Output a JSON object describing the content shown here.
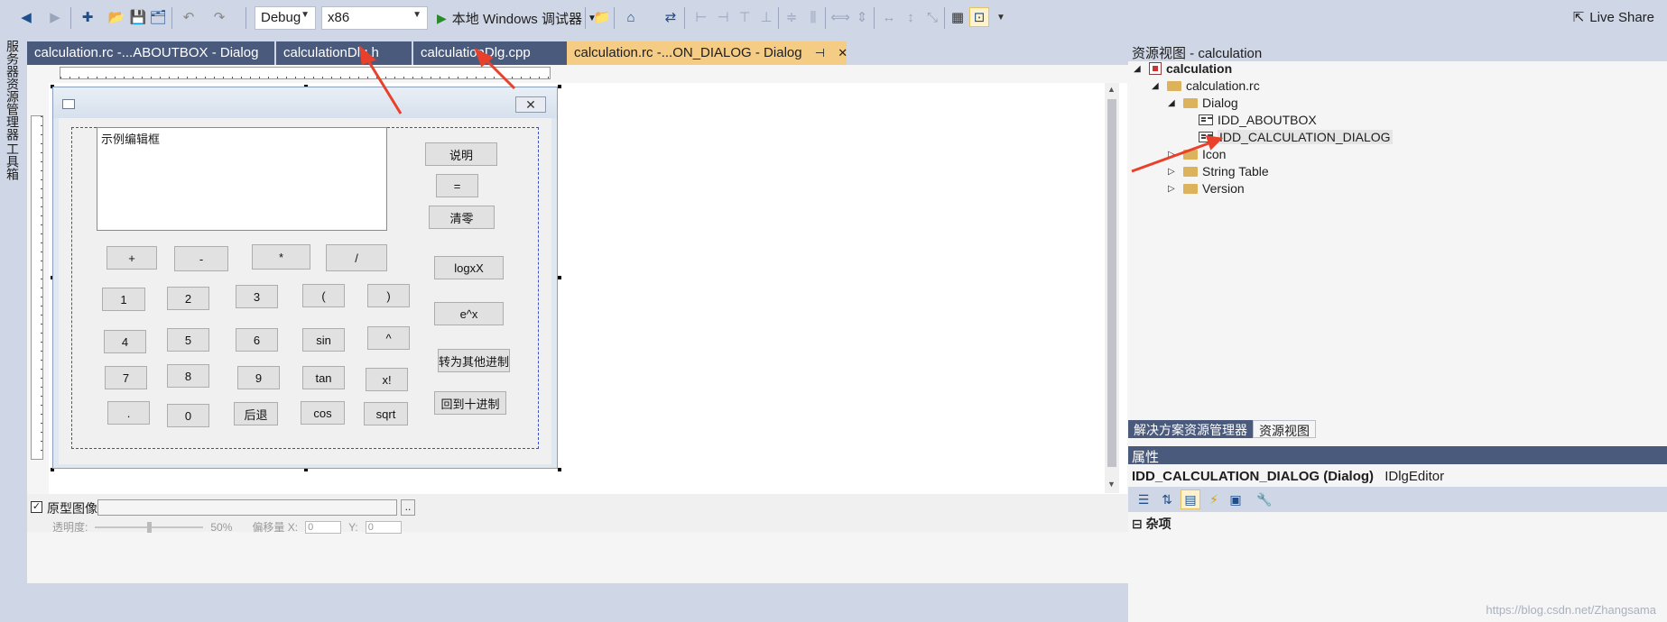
{
  "toolbar": {
    "config": "Debug",
    "platform": "x86",
    "run_label": "本地 Windows 调试器",
    "live_share": "Live Share",
    "icons": [
      "back-icon",
      "forward-icon",
      "new-project-icon",
      "open-icon",
      "save-icon",
      "save-all-icon",
      "undo-icon",
      "redo-icon"
    ]
  },
  "left_strip": {
    "server_explorer": "服务器资源管理器",
    "toolbox": "工具箱"
  },
  "doc_tabs": [
    {
      "label": "calculation.rc -...ABOUTBOX - Dialog"
    },
    {
      "label": "calculationDlg.h"
    },
    {
      "label": "calculationDlg.cpp"
    },
    {
      "label": "calculation.rc -...ON_DIALOG - Dialog"
    }
  ],
  "dialog": {
    "edit_text": "示例编辑框",
    "buttons": {
      "explain": "说明",
      "equals": "=",
      "clear": "清零",
      "plus": "+",
      "minus": "-",
      "multiply": "*",
      "divide": "/",
      "logxX": "logxX",
      "one": "1",
      "two": "2",
      "three": "3",
      "lparen": "(",
      "rparen": ")",
      "exp": "e^x",
      "four": "4",
      "five": "5",
      "six": "6",
      "sin": "sin",
      "caret": "^",
      "to_other_base": "转为其他进制",
      "seven": "7",
      "eight": "8",
      "nine": "9",
      "tan": "tan",
      "factorial": "x!",
      "back_to_decimal": "回到十进制",
      "dot": ".",
      "zero": "0",
      "backspace": "后退",
      "cos": "cos",
      "sqrt": "sqrt"
    }
  },
  "bottom_bar": {
    "prototype_image": "原型图像:",
    "browse": "..",
    "opacity": "透明度:",
    "opacity_value": "50%",
    "offset": "偏移量 X:",
    "x_value": "0",
    "y_label": "Y:",
    "y_value": "0"
  },
  "right_panel": {
    "title": "资源视图 - calculation",
    "tree": {
      "root": "calculation",
      "rc": "calculation.rc",
      "dialog_folder": "Dialog",
      "about": "IDD_ABOUTBOX",
      "calc": "IDD_CALCULATION_DIALOG",
      "icon": "Icon",
      "string_table": "String Table",
      "version": "Version"
    },
    "tabs": [
      "解决方案资源管理器",
      "资源视图"
    ],
    "props_title": "属性",
    "props_object": "IDD_CALCULATION_DIALOG (Dialog)",
    "props_editor": "IDlgEditor",
    "props_category": "杂项"
  },
  "watermark": "https://blog.csdn.net/Zhangsama"
}
